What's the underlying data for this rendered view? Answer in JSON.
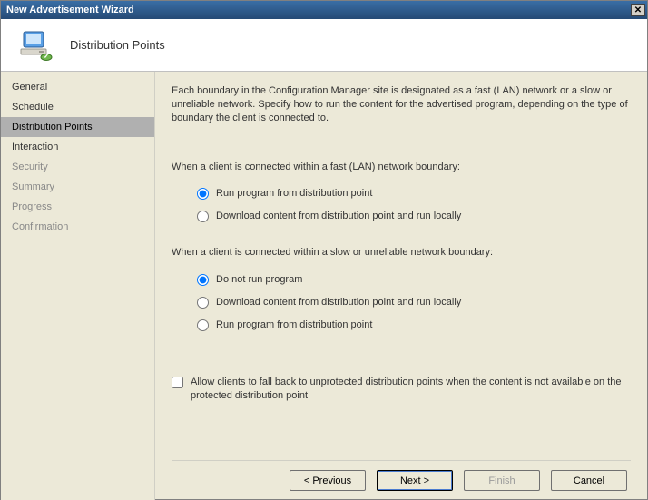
{
  "window": {
    "title": "New Advertisement Wizard"
  },
  "header": {
    "title": "Distribution Points"
  },
  "sidebar": {
    "items": [
      {
        "label": "General",
        "state": "normal"
      },
      {
        "label": "Schedule",
        "state": "normal"
      },
      {
        "label": "Distribution Points",
        "state": "active"
      },
      {
        "label": "Interaction",
        "state": "normal"
      },
      {
        "label": "Security",
        "state": "disabled"
      },
      {
        "label": "Summary",
        "state": "disabled"
      },
      {
        "label": "Progress",
        "state": "disabled"
      },
      {
        "label": "Confirmation",
        "state": "disabled"
      }
    ]
  },
  "content": {
    "intro": "Each boundary in the Configuration Manager site is designated as a fast (LAN) network or a slow or unreliable network. Specify how to run the content for the advertised program, depending on the type of boundary the client is connected to.",
    "fast": {
      "label": "When a client is connected within a fast (LAN) network boundary:",
      "options": [
        "Run program from distribution point",
        "Download content from distribution point and run locally"
      ]
    },
    "slow": {
      "label": "When a client is connected within a slow or unreliable network boundary:",
      "options": [
        "Do not run program",
        "Download content from distribution point and run locally",
        "Run program from distribution point"
      ]
    },
    "fallback_checkbox": "Allow clients to fall back to unprotected distribution points when the content is not available on the protected distribution point"
  },
  "buttons": {
    "previous": "< Previous",
    "next": "Next >",
    "finish": "Finish",
    "cancel": "Cancel"
  }
}
